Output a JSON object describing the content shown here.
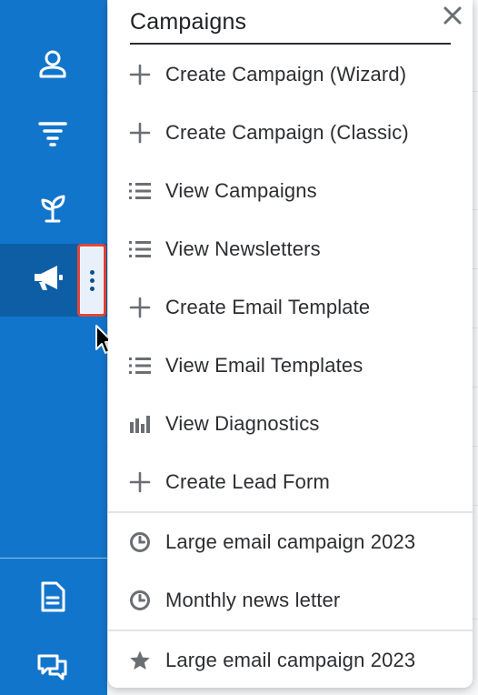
{
  "flyout": {
    "title": "Campaigns",
    "actions": [
      {
        "label": "Create Campaign (Wizard)",
        "icon": "plus-icon"
      },
      {
        "label": "Create Campaign (Classic)",
        "icon": "plus-icon"
      },
      {
        "label": "View Campaigns",
        "icon": "list-icon"
      },
      {
        "label": "View Newsletters",
        "icon": "list-icon"
      },
      {
        "label": "Create Email Template",
        "icon": "plus-icon"
      },
      {
        "label": "View Email Templates",
        "icon": "list-icon"
      },
      {
        "label": "View Diagnostics",
        "icon": "bar-chart-icon"
      },
      {
        "label": "Create Lead Form",
        "icon": "plus-icon"
      }
    ],
    "recently_viewed": [
      {
        "label": "Large email campaign 2023",
        "icon": "clock-icon"
      },
      {
        "label": "Monthly news letter",
        "icon": "clock-icon"
      }
    ],
    "favorites": [
      {
        "label": "Large email campaign 2023",
        "icon": "star-icon"
      }
    ]
  },
  "sidebar": {
    "items": [
      {
        "icon": "contact-icon"
      },
      {
        "icon": "filter-icon"
      },
      {
        "icon": "sprout-icon"
      },
      {
        "icon": "megaphone-icon",
        "active": true
      }
    ],
    "bottom_items": [
      {
        "icon": "document-icon"
      },
      {
        "icon": "chat-icon"
      }
    ]
  },
  "colors": {
    "sidebar": "#1275cc",
    "sidebar_active": "#0e5ea6",
    "highlight_border": "#e0473b",
    "menu_text": "#2c2e31",
    "icon_gray": "#6b6e73"
  }
}
